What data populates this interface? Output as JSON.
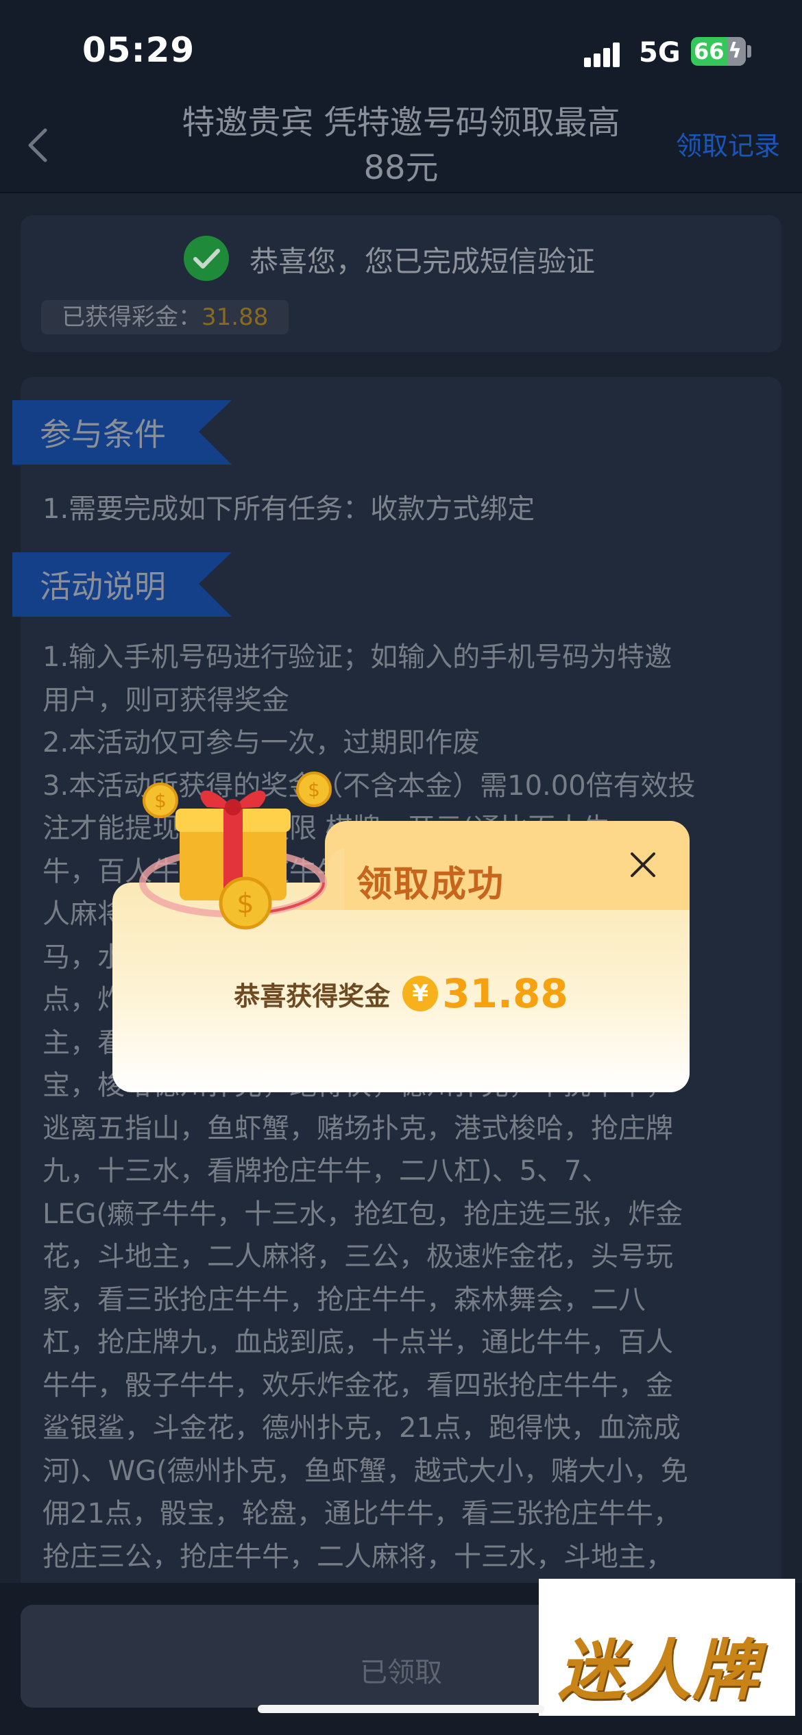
{
  "status_bar": {
    "time": "05:29",
    "network": "5G",
    "battery": "66"
  },
  "nav": {
    "title": "特邀贵宾 凭特邀号码领取最高88元",
    "right_link": "领取记录"
  },
  "verify": {
    "message": "恭喜您，您已完成短信验证",
    "reward_label": "已获得彩金：",
    "reward_value": "31.88"
  },
  "sections": {
    "conditions": {
      "title": "参与条件",
      "text": "1.需要完成如下所有任务：收款方式绑定"
    },
    "description": {
      "title": "活动说明",
      "lines": [
        "1.输入手机号码进行验证；如输入的手机号码为特邀",
        "用户，则可获得奖金",
        "2.本活动仅可参与一次，过期即作废",
        "3.本活动所获得的奖金（不含本金）需10.00倍有效投",
        "注才能提现，投注仅限 棋牌 - 开元(通比百人牛",
        "牛，百人牛牛，抢庄牛牛，看牌抢庄牛牛，二",
        "人麻将，炸金花，抢庄牌九，奔驰宝",
        "马，水果机，骰宝，十三水，二八杠，21",
        "点，炸金花，看三张抢庄牛牛，斗地",
        "主，看四张抢庄牛牛，百人牛牛，人骰",
        "宝，梭哈德州扑克，跑得快，德州扑克，单挑牛牛，",
        "逃离五指山，鱼虾蟹，赌场扑克，港式梭哈，抢庄牌",
        "九，十三水，看牌抢庄牛牛，二八杠)、5、7、",
        "LEG(癞子牛牛，十三水，抢红包，抢庄选三张，炸金",
        "花，斗地主，二人麻将，三公，极速炸金花，头号玩",
        "家，看三张抢庄牛牛，抢庄牛牛，森林舞会，二八",
        "杠，抢庄牌九，血战到底，十点半，通比牛牛，百人",
        "牛牛，骰子牛牛，欢乐炸金花，看四张抢庄牛牛，金",
        "鲨银鲨，斗金花，德州扑克，21点，跑得快，血流成",
        "河)、WG(德州扑克，鱼虾蟹，越式大小，赌大小，免",
        "佣21点，骰宝，轮盘，通比牛牛，看三张抢庄牛牛，",
        "抢庄三公，抢庄牛牛，二人麻将，十三水，斗地主，"
      ]
    }
  },
  "bottom": {
    "button_label": "已领取"
  },
  "modal": {
    "title": "领取成功",
    "body_label": "恭喜获得奖金",
    "currency_symbol": "¥",
    "amount": "31.88"
  },
  "watermark": {
    "text": "迷人牌"
  },
  "icons": {
    "back": "chevron-left-icon",
    "check": "check-circle-icon",
    "close": "close-icon",
    "currency": "yen-coin-icon",
    "gift": "gift-box-illustration"
  },
  "colors": {
    "background": "#1b2230",
    "link": "#1a56b8",
    "success": "#2db84b",
    "ribbon": "#1452a8",
    "modal_title": "#c7651c",
    "modal_amount": "#f6a10f",
    "reward_value": "#8a6a1f"
  }
}
